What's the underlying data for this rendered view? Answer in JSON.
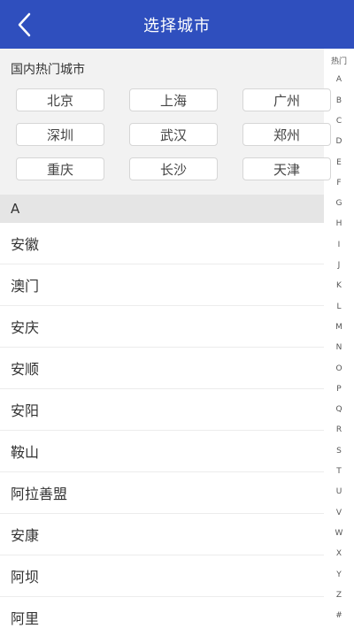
{
  "header": {
    "title": "选择城市",
    "back_icon": "chevron-left-icon"
  },
  "hot": {
    "title": "国内热门城市",
    "cities": [
      "北京",
      "上海",
      "广州",
      "深圳",
      "武汉",
      "郑州",
      "重庆",
      "长沙",
      "天津"
    ]
  },
  "section": {
    "letter": "A"
  },
  "list": [
    "安徽",
    "澳门",
    "安庆",
    "安顺",
    "安阳",
    "鞍山",
    "阿拉善盟",
    "安康",
    "阿坝",
    "阿里"
  ],
  "index": [
    "热门",
    "A",
    "B",
    "C",
    "D",
    "E",
    "F",
    "G",
    "H",
    "I",
    "J",
    "K",
    "L",
    "M",
    "N",
    "O",
    "P",
    "Q",
    "R",
    "S",
    "T",
    "U",
    "V",
    "W",
    "X",
    "Y",
    "Z",
    "#"
  ],
  "colors": {
    "header_bg": "#2f4fbe",
    "hot_bg": "#f2f2f2",
    "section_bg": "#e5e5e5"
  }
}
